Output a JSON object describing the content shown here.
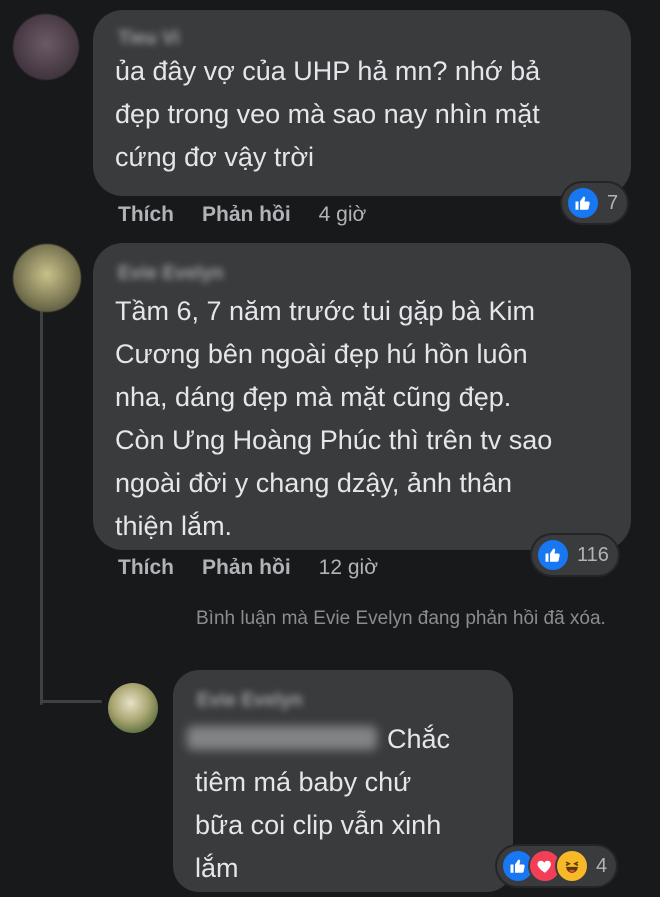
{
  "comments": [
    {
      "author": "Tieu Vi",
      "text": "ủa đây vợ của UHP hả mn? nhớ bả\nđẹp trong veo mà sao nay nhìn mặt\ncứng đơ vậy trời",
      "like_label": "Thích",
      "reply_label": "Phản hồi",
      "time": "4 giờ",
      "reaction_count": "7",
      "reactions": [
        "like-icon"
      ]
    },
    {
      "author": "Evie Evelyn",
      "text": "Tầm 6, 7 năm trước tui gặp bà Kim\nCương bên ngoài đẹp hú hồn luôn\nnha, dáng đẹp mà mặt cũng đẹp.\nCòn Ưng Hoàng Phúc thì trên tv sao\nngoài đời y chang dzậy, ảnh thân\nthiện lắm.",
      "like_label": "Thích",
      "reply_label": "Phản hồi",
      "time": "12 giờ",
      "reaction_count": "116",
      "reactions": [
        "like-icon"
      ]
    }
  ],
  "deleted_note": "Bình luận mà Evie Evelyn đang phản hồi đã xóa.",
  "reply": {
    "author": "Evie Evelyn",
    "text_line1": "Chắc",
    "text_rest": "tiêm má baby chứ\nbữa coi clip vẫn xinh\nlắm",
    "reaction_count": "4",
    "reactions": [
      "like-icon",
      "love-icon",
      "haha-icon"
    ]
  },
  "colors": {
    "background": "#18191a",
    "bubble": "#3a3b3c",
    "text": "#e4e6eb",
    "secondary_text": "#b0b3b8",
    "like": "#1877f2",
    "love": "#f33e58",
    "haha": "#f7b928"
  }
}
